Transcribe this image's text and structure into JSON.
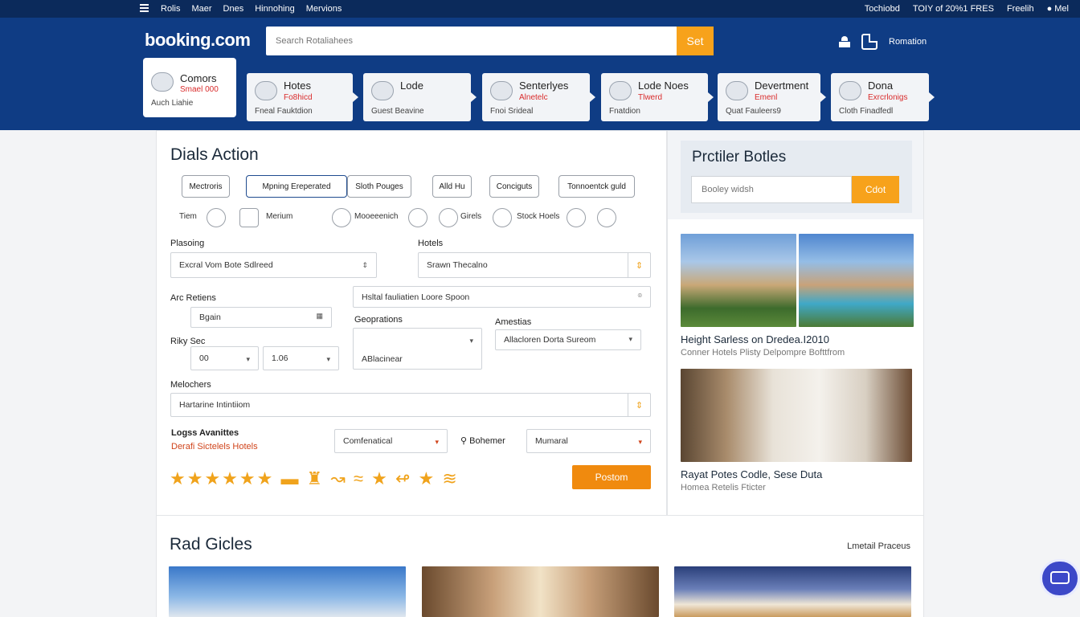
{
  "topbar": {
    "left_items": [
      "Rolis",
      "Maer",
      "Dnes",
      "Hinnohing",
      "Mervions"
    ],
    "right_items": [
      "Tochiobd",
      "TOIY of 20%1 FRES",
      "Freelih",
      "Mel"
    ]
  },
  "header": {
    "logo": "booking.com",
    "search_placeholder": "Search Rotaliahees",
    "search_button": "Set",
    "account_label": "Romation"
  },
  "categories": [
    {
      "title": "Comors",
      "sub": "Smael 000",
      "foot": "Auch Liahie"
    },
    {
      "title": "Hotes",
      "sub": "Fo8hicd",
      "foot": "Fneal Fauktdion"
    },
    {
      "title": "Lode",
      "sub": "",
      "foot": "Guest Beavine"
    },
    {
      "title": "Senterlyes",
      "sub": "Alnetelc",
      "foot": "Fnoi Srideal"
    },
    {
      "title": "Lode Noes",
      "sub": "Tlwerd",
      "foot": "Fnatdion"
    },
    {
      "title": "Devertment",
      "sub": "Emenl",
      "foot": "Quat Fauleers9"
    },
    {
      "title": "Dona",
      "sub": "Exrcrlonigs",
      "foot": "Cloth Finadfedl"
    }
  ],
  "main": {
    "title": "Dials Action",
    "chips": [
      "Mectroris",
      "Mpning Ereperated",
      "Sloth Pouges",
      "Alld Hu",
      "Conciguts",
      "Tonnoentck guld"
    ],
    "icon_row": [
      "Tiem",
      "Merium",
      "Mooeeenich",
      "Girels",
      "Stock Hoels"
    ],
    "placing_label": "Plasoing",
    "placing_value": "Excral Vom Bote Sdlreed",
    "hotels_label": "Hotels",
    "hotels_value": "Srawn Thecalno",
    "arc_label": "Arc Retiens",
    "arc_value": "Bgain",
    "hotel_search": "Hsltal fauliatien Loore Spoon",
    "rate_label": "Riky Sec",
    "rate_a": "00",
    "rate_b": "1.06",
    "geo_label": "Geoprations",
    "geo_value": "ABlacinear",
    "amen_label": "Amestias",
    "amen_value": "Allacloren Dorta Sureom",
    "mel_label": "Melochers",
    "mel_value": "Hartarine Intintiiom",
    "logs_label": "Logss Avanittes",
    "logs_link": "Derafi Sictelels Hotels",
    "select1": "Comfenatical",
    "bohemer": "Bohemer",
    "select2": "Mumaral",
    "stars_text": "★★★★★★ ▬ ♜ ↝ ≈ ★ ↫  ★ ≋",
    "post_button": "Postom"
  },
  "side": {
    "title": "Prctiler Botles",
    "search_placeholder": "Booley widsh",
    "go_button": "Cdot",
    "card1_title": "Height Sarless on Dredea.I2010",
    "card1_sub": "Conner Hotels Plisty Delpompre Bofttfrom",
    "card2_title": "Rayat Potes Codle, Sese Duta",
    "card2_sub": "Homea Retelis Fticter"
  },
  "bottom": {
    "title": "Rad Gicles",
    "link": "Lmetail Praceus"
  },
  "colors": {
    "brand": "#0f3c84",
    "accent": "#f7a21b",
    "topbar": "#0b2a5b"
  }
}
